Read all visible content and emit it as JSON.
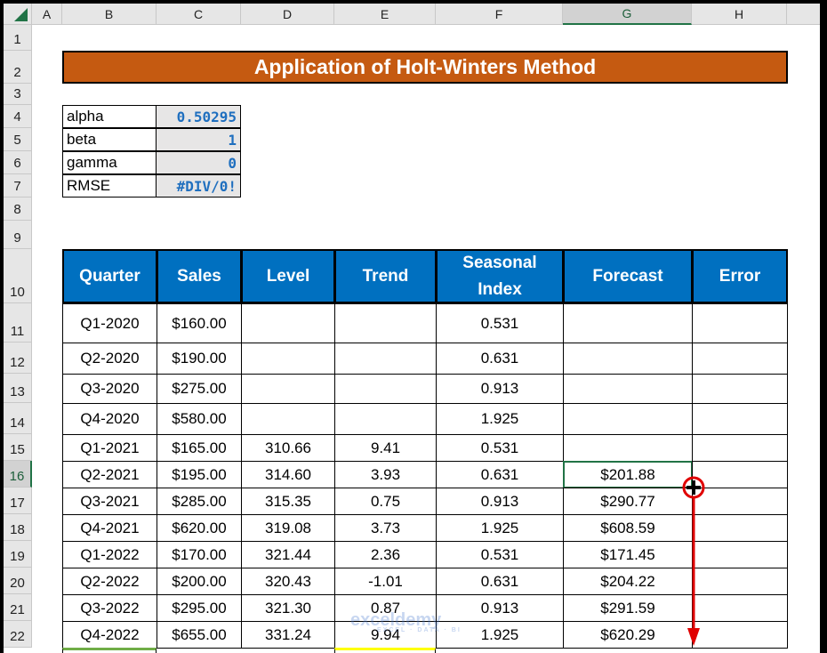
{
  "columns": [
    "A",
    "B",
    "C",
    "D",
    "E",
    "F",
    "G",
    "H"
  ],
  "selected_column": "G",
  "rows": [
    "1",
    "2",
    "3",
    "4",
    "5",
    "6",
    "7",
    "8",
    "9",
    "10",
    "11",
    "12",
    "13",
    "14",
    "15",
    "16",
    "17",
    "18",
    "19",
    "20",
    "21",
    "22"
  ],
  "selected_row": "16",
  "title": "Application of Holt-Winters Method",
  "params": [
    {
      "label": "alpha",
      "value": "0.50295"
    },
    {
      "label": "beta",
      "value": "1"
    },
    {
      "label": "gamma",
      "value": "0"
    },
    {
      "label": "RMSE",
      "value": "#DIV/0!"
    }
  ],
  "table": {
    "headers": [
      "Quarter",
      "Sales",
      "Level",
      "Trend",
      "Seasonal Index",
      "Forecast",
      "Error"
    ],
    "rows": [
      [
        "Q1-2020",
        "$160.00",
        "",
        "",
        "0.531",
        "",
        ""
      ],
      [
        "Q2-2020",
        "$190.00",
        "",
        "",
        "0.631",
        "",
        ""
      ],
      [
        "Q3-2020",
        "$275.00",
        "",
        "",
        "0.913",
        "",
        ""
      ],
      [
        "Q4-2020",
        "$580.00",
        "",
        "",
        "1.925",
        "",
        ""
      ],
      [
        "Q1-2021",
        "$165.00",
        "310.66",
        "9.41",
        "0.531",
        "",
        ""
      ],
      [
        "Q2-2021",
        "$195.00",
        "314.60",
        "3.93",
        "0.631",
        "$201.88",
        ""
      ],
      [
        "Q3-2021",
        "$285.00",
        "315.35",
        "0.75",
        "0.913",
        "$290.77",
        ""
      ],
      [
        "Q4-2021",
        "$620.00",
        "319.08",
        "3.73",
        "1.925",
        "$608.59",
        ""
      ],
      [
        "Q1-2022",
        "$170.00",
        "321.44",
        "2.36",
        "0.531",
        "$171.45",
        ""
      ],
      [
        "Q2-2022",
        "$200.00",
        "320.43",
        "-1.01",
        "0.631",
        "$204.22",
        ""
      ],
      [
        "Q3-2022",
        "$295.00",
        "321.30",
        "0.87",
        "0.913",
        "$291.59",
        ""
      ],
      [
        "Q4-2022",
        "$655.00",
        "331.24",
        "9.94",
        "1.925",
        "$620.29",
        ""
      ]
    ]
  },
  "selected_cell": "G16",
  "annotation_color": "#e00000",
  "watermark": {
    "brand": "exceldemy",
    "tagline": "EXCEL · DATA · BI"
  }
}
